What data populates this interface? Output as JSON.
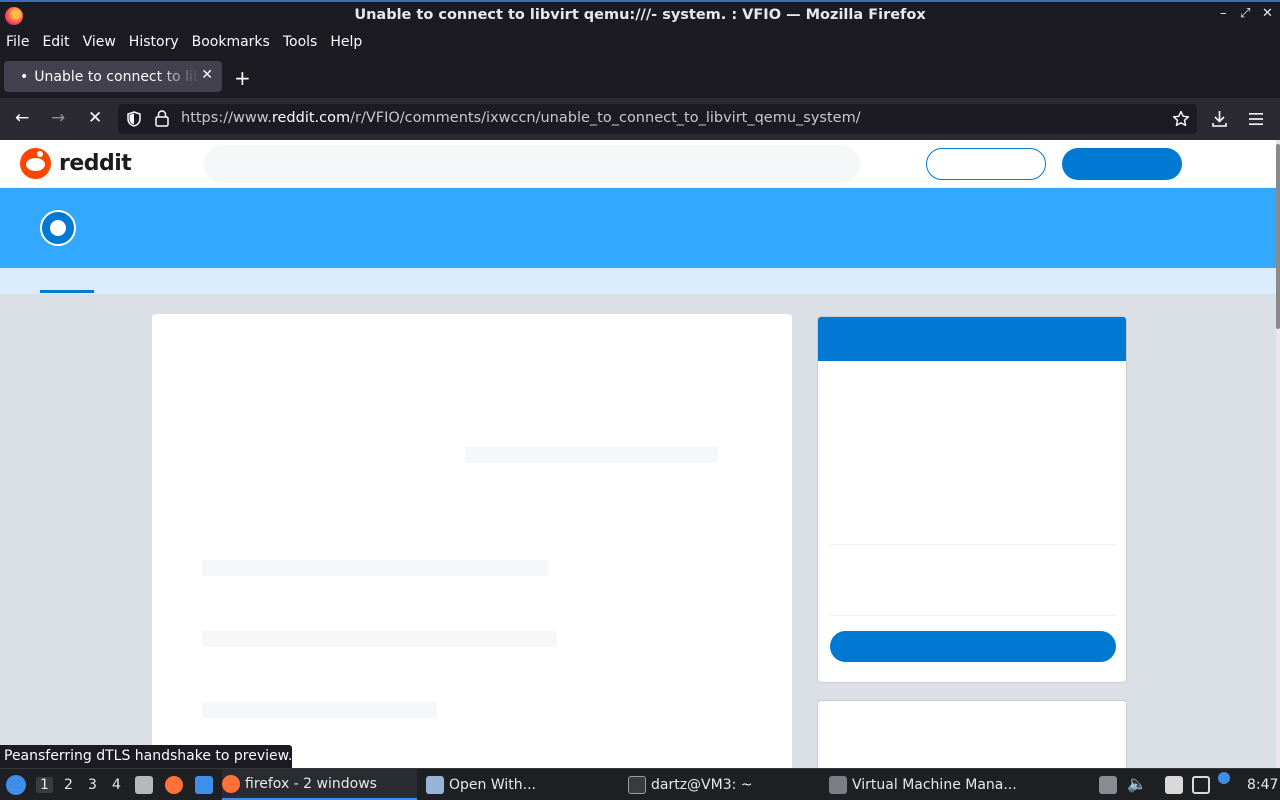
{
  "window": {
    "title": "Unable to connect to libvirt qemu:///- system. : VFIO — Mozilla Firefox",
    "controls": {
      "minimize": "–",
      "maximize": "⤢",
      "close": "✕"
    }
  },
  "menu": [
    "File",
    "Edit",
    "View",
    "History",
    "Bookmarks",
    "Tools",
    "Help"
  ],
  "tab": {
    "dot": "•",
    "title": "Unable to connect to libvirt",
    "close": "✕"
  },
  "newtab": "+",
  "nav": {
    "back": "←",
    "forward": "→",
    "stop": "✕"
  },
  "url": {
    "prefix": "https://www.",
    "host": "reddit.com",
    "path": "/r/VFIO/comments/ixwccn/unable_to_connect_to_libvirt_qemu_system/"
  },
  "reddit": {
    "wordmark": "reddit"
  },
  "status_text": "Peansferring dTLS handshake to preview.red",
  "taskbar": {
    "workspaces": [
      "1",
      "2",
      "3",
      "4"
    ],
    "tasks": [
      {
        "label": "firefox - 2 windows",
        "active": true
      },
      {
        "label": "Open With...",
        "active": false
      },
      {
        "label": "dartz@VM3: ~",
        "active": false
      },
      {
        "label": "Virtual Machine Mana...",
        "active": false
      }
    ],
    "clock": "8:47"
  },
  "colors": {
    "reddit_orange": "#ff4500",
    "reddit_blue": "#0079d3",
    "banner_blue": "#33a8ff",
    "firefox_dark": "#1c1b22"
  }
}
